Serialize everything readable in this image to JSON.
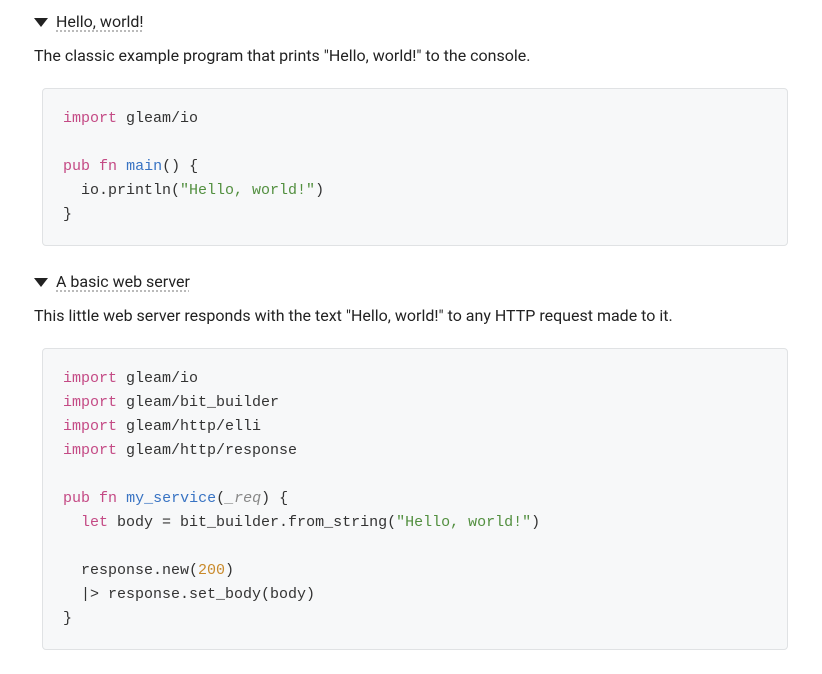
{
  "sections": [
    {
      "title": "Hello, world!",
      "description": "The classic example program that prints \"Hello, world!\" to the console.",
      "code": {
        "kw_import": "import",
        "mod1": "gleam/io",
        "kw_pub": "pub",
        "kw_fn": "fn",
        "fn_name": "main",
        "sig_open": "() {",
        "body_line": "  io.println(",
        "str1": "\"Hello, world!\"",
        "body_close": ")",
        "brace_close": "}"
      }
    },
    {
      "title": "A basic web server",
      "description": "This little web server responds with the text \"Hello, world!\" to any HTTP request made to it.",
      "code": {
        "kw_import": "import",
        "mod1": "gleam/io",
        "mod2": "gleam/bit_builder",
        "mod3": "gleam/http/elli",
        "mod4": "gleam/http/response",
        "kw_pub": "pub",
        "kw_fn": "fn",
        "fn_name": "my_service",
        "sig_open": "(",
        "arg1": "_req",
        "sig_close": ") {",
        "kw_let": "let",
        "let_line_a": " body = bit_builder.from_string(",
        "str1": "\"Hello, world!\"",
        "let_line_b": ")",
        "resp_new_a": "  response.new(",
        "num200": "200",
        "resp_new_b": ")",
        "pipe_line": "  |> response.set_body(body)",
        "brace_close": "}"
      }
    }
  ]
}
